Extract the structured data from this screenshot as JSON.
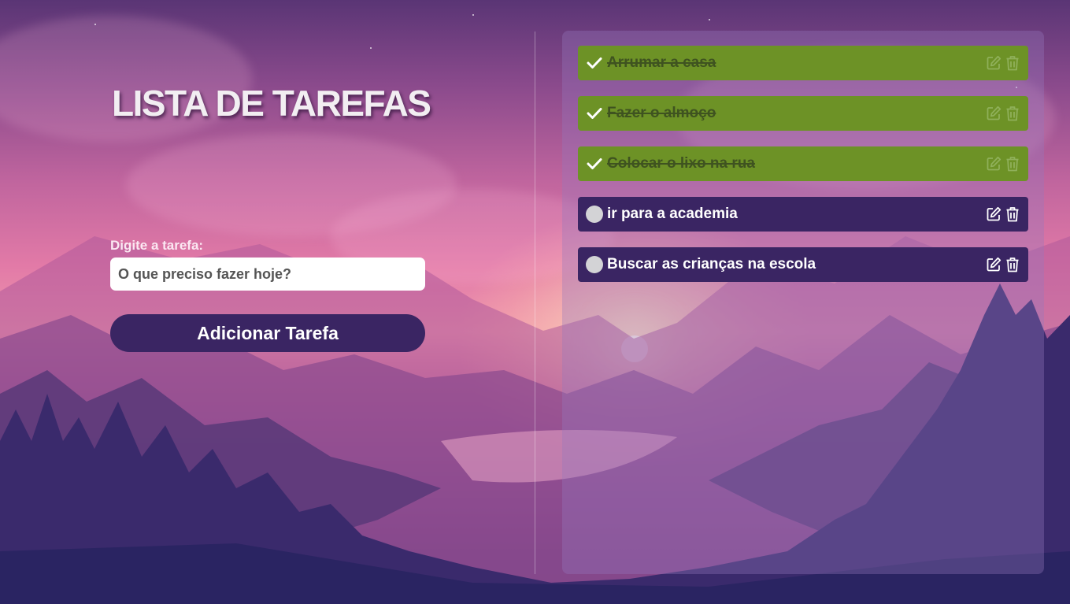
{
  "header": {
    "title": "LISTA DE TAREFAS"
  },
  "form": {
    "label": "Digite a tarefa:",
    "placeholder": "O que preciso fazer hoje?",
    "value": "",
    "add_button_label": "Adicionar Tarefa"
  },
  "tasks": [
    {
      "text": "Arrumar a casa",
      "done": true
    },
    {
      "text": "Fazer o almoço",
      "done": true
    },
    {
      "text": "Colocar o lixo na rua",
      "done": true
    },
    {
      "text": "ir para a academia",
      "done": false
    },
    {
      "text": "Buscar as crianças na escola",
      "done": false
    }
  ],
  "icons": {
    "done_status": "check-icon",
    "todo_status": "circle-icon",
    "edit": "edit-icon",
    "delete": "trash-icon"
  },
  "colors": {
    "done_task_bg": "#6d9226",
    "todo_task_bg": "#3a2563",
    "button_bg": "#3a2563"
  }
}
